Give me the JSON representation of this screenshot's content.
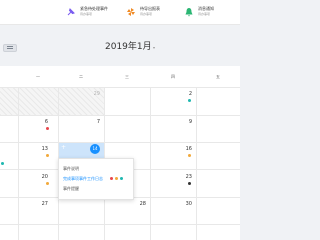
{
  "topbar": {
    "stats": [
      {
        "label": "紧急待处理事件",
        "sub": "待办事项",
        "icon": "thumbtack-icon",
        "color": "#7a5cf0"
      },
      {
        "label": "待导出报表",
        "sub": "待办事项",
        "icon": "pinwheel-icon",
        "color": "#f08a24"
      },
      {
        "label": "消息通知",
        "sub": "待办事项",
        "icon": "bell-icon",
        "color": "#2bb673"
      }
    ]
  },
  "calendar": {
    "title": "2019年1月",
    "caret": "▾",
    "weekdays": [
      "",
      "一",
      "二",
      "三",
      "四",
      "五"
    ],
    "days": {
      "r1": [
        "",
        "",
        "29",
        "",
        "",
        "2"
      ],
      "r2": [
        "",
        "6",
        "7",
        "",
        "",
        "9"
      ],
      "r3": [
        "",
        "13",
        "",
        "14",
        "",
        "16"
      ],
      "r4": [
        "",
        "20",
        "",
        "",
        "",
        "23"
      ],
      "r5": [
        "",
        "27",
        "",
        "28",
        "",
        "30"
      ]
    },
    "today": "14"
  },
  "popup": {
    "items": [
      "事件说明",
      "完成事项事件工作日志",
      "事件提醒"
    ]
  },
  "colors": {
    "accent": "#1890ff",
    "red": "#e8464b",
    "orange": "#f2a93b",
    "teal": "#1fb8b0",
    "dark": "#333333"
  }
}
